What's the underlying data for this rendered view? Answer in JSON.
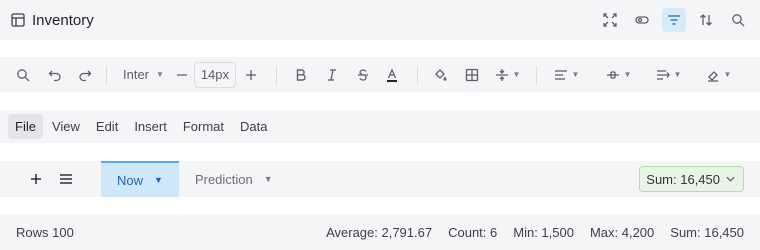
{
  "titlebar": {
    "title": "Inventory"
  },
  "toolbar": {
    "font_name": "Inter",
    "font_size": "14px"
  },
  "menubar": {
    "items": [
      "File",
      "View",
      "Edit",
      "Insert",
      "Format",
      "Data"
    ]
  },
  "sheets": {
    "tabs": [
      {
        "label": "Now"
      },
      {
        "label": "Prediction"
      }
    ],
    "sum_chip": "Sum: 16,450"
  },
  "status": {
    "rows": "Rows 100",
    "average": "Average: 2,791.67",
    "count": "Count: 6",
    "min": "Min: 1,500",
    "max": "Max: 4,200",
    "sum": "Sum: 16,450"
  },
  "colors": {
    "accent_tab": "#cfe8f9",
    "active_icon_bg": "#d6ecfa",
    "sum_chip_bg": "#e7f4e6"
  }
}
